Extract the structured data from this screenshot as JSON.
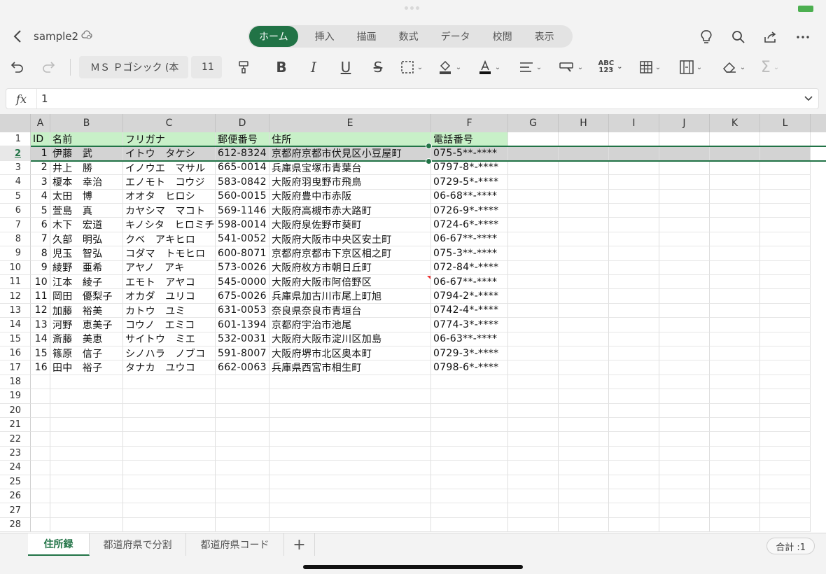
{
  "app": {
    "doc_name": "sample2",
    "accent": "#217346"
  },
  "ribbon_tabs": [
    {
      "label": "ホーム",
      "active": true
    },
    {
      "label": "挿入"
    },
    {
      "label": "描画"
    },
    {
      "label": "数式"
    },
    {
      "label": "データ"
    },
    {
      "label": "校閲"
    },
    {
      "label": "表示"
    }
  ],
  "toolbar": {
    "font_name": "ＭＳ Ｐゴシック (本",
    "font_size": "11"
  },
  "formula_bar": {
    "fx": "fx",
    "value": "1"
  },
  "columns": [
    "A",
    "B",
    "C",
    "D",
    "E",
    "F",
    "G",
    "H",
    "I",
    "J",
    "K",
    "L"
  ],
  "rows": [
    [
      "ID",
      "名前",
      "フリガナ",
      "郵便番号",
      "住所",
      "電話番号"
    ],
    [
      "1",
      "伊藤　武",
      "イトウ　タケシ",
      "612-8324",
      "京都府京都市伏見区小豆屋町",
      "075-5**-****"
    ],
    [
      "2",
      "井上　勝",
      "イノウエ　マサル",
      "665-0014",
      "兵庫県宝塚市青葉台",
      "0797-8*-****"
    ],
    [
      "3",
      "榎本　幸治",
      "エノモト　コウジ",
      "583-0842",
      "大阪府羽曳野市飛鳥",
      "0729-5*-****"
    ],
    [
      "4",
      "太田　博",
      "オオタ　ヒロシ",
      "560-0015",
      "大阪府豊中市赤阪",
      "06-68**-****"
    ],
    [
      "5",
      "萱島　真",
      "カヤシマ　マコト",
      "569-1146",
      "大阪府高槻市赤大路町",
      "0726-9*-****"
    ],
    [
      "6",
      "木下　宏道",
      "キノシタ　ヒロミチ",
      "598-0014",
      "大阪府泉佐野市葵町",
      "0724-6*-****"
    ],
    [
      "7",
      "久部　明弘",
      "クベ　アキヒロ",
      "541-0052",
      "大阪府大阪市中央区安土町",
      "06-67**-****"
    ],
    [
      "8",
      "児玉　智弘",
      "コダマ　トモヒロ",
      "600-8071",
      "京都府京都市下京区相之町",
      "075-3**-****"
    ],
    [
      "9",
      "綾野　亜希",
      "アヤノ　アキ",
      "573-0026",
      "大阪府枚方市朝日丘町",
      "072-84*-****"
    ],
    [
      "10",
      "江本　綾子",
      "エモト　アヤコ",
      "545-0000",
      "大阪府大阪市阿倍野区",
      "06-67**-****"
    ],
    [
      "11",
      "岡田　優梨子",
      "オカダ　ユリコ",
      "675-0026",
      "兵庫県加古川市尾上町旭",
      "0794-2*-****"
    ],
    [
      "12",
      "加藤　裕美",
      "カトウ　ユミ",
      "631-0053",
      "奈良県奈良市青垣台",
      "0742-4*-****"
    ],
    [
      "13",
      "河野　恵美子",
      "コウノ　エミコ",
      "601-1394",
      "京都府宇治市池尾",
      "0774-3*-****"
    ],
    [
      "14",
      "斎藤　美恵",
      "サイトウ　ミエ",
      "532-0031",
      "大阪府大阪市淀川区加島",
      "06-63**-****"
    ],
    [
      "15",
      "篠原　信子",
      "シノハラ　ノブコ",
      "591-8007",
      "大阪府堺市北区奥本町",
      "0729-3*-****"
    ],
    [
      "16",
      "田中　裕子",
      "タナカ　ユウコ",
      "662-0063",
      "兵庫県西宮市相生町",
      "0798-6*-****"
    ]
  ],
  "row_numbers": [
    "1",
    "2",
    "3",
    "4",
    "5",
    "6",
    "7",
    "8",
    "9",
    "10",
    "11",
    "12",
    "13",
    "14",
    "15",
    "16",
    "17",
    "18",
    "19",
    "20",
    "21",
    "22",
    "23",
    "24",
    "25",
    "26",
    "27",
    "28"
  ],
  "sheet_tabs": [
    {
      "label": "住所録",
      "active": true
    },
    {
      "label": "都道府県で分割"
    },
    {
      "label": "都道府県コード"
    }
  ],
  "add_sheet": "+",
  "status": {
    "sum": "合計 :1"
  }
}
